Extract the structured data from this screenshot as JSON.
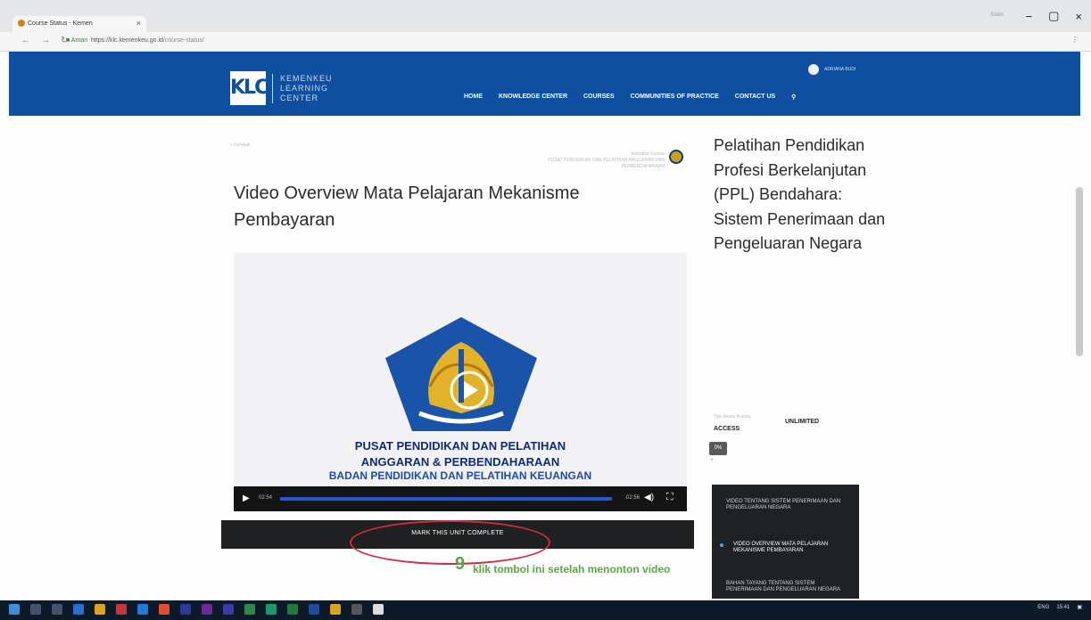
{
  "browser": {
    "tab_title": "Course Status - Kemen",
    "tab_close": "×",
    "address_secure": "Aman",
    "address_url": "https://klc.kemenkeu.go.id",
    "address_path": "/course-status/",
    "window_user": "Sisko",
    "win_min": "−",
    "win_max": "▢",
    "win_close": "×"
  },
  "site": {
    "logo_mark": "KLC",
    "logo_line1": "KEMENKEU",
    "logo_line2": "LEARNING",
    "logo_line3": "CENTER",
    "nav": [
      "HOME",
      "KNOWLEDGE CENTER",
      "COURSES",
      "COMMUNITIES OF PRACTICE",
      "CONTACT US"
    ],
    "user_name": "ADRIANA BUDI"
  },
  "content": {
    "breadcrumb": "« Kembali",
    "instructor_label": "Instruktur Kursus",
    "instructor_name": "PUSAT PENDIDIKAN DAN PELATIHAN ANGGARAN DAN PERBENDAHARAAN",
    "page_title": "Video Overview Mata Pelajaran Mekanisme Pembayaran",
    "video": {
      "line1": "PUSAT PENDIDIKAN DAN PELATIHAN",
      "line2": "ANGGARAN & PERBENDAHARAAN",
      "line3": "BADAN PENDIDIKAN DAN PELATIHAN KEUANGAN",
      "time_elapsed": "02:54",
      "time_total": "02:56",
      "progress": 0.99
    },
    "mark_complete_label": "MARK THIS UNIT COMPLETE",
    "annotation_number": "9",
    "annotation_text": "klik tombol ini setelah menonton video"
  },
  "sidebar": {
    "course_title": "Pelatihan Pendidikan Profesi Berkelanjutan (PPL) Bendahara: Sistem Penerimaan dan Pengeluaran Negara",
    "access_label": "Tipe Akses Kursus",
    "access_value_1": "UNLIMITED",
    "access_value_2": "ACCESS",
    "progress_label": "0%",
    "progress_dot": "•",
    "units": [
      "VIDEO TENTANG SISTEM PENERIMAAN DAN PENGELUARAN NEGARA",
      "VIDEO OVERVIEW MATA PELAJARAN MEKANISME PEMBAYARAN",
      "BAHAN TAYANG TENTANG SISTEM PENERIMAAN DAN PENGELUARAN NEGARA"
    ]
  },
  "taskbar": {
    "lang": "ENG",
    "time": "15:41"
  },
  "colors": {
    "header_blue": "#0f4fa0",
    "dark_panel": "#1f2224",
    "annotation_red": "#cc2e3a",
    "annotation_green": "#5aa640"
  }
}
